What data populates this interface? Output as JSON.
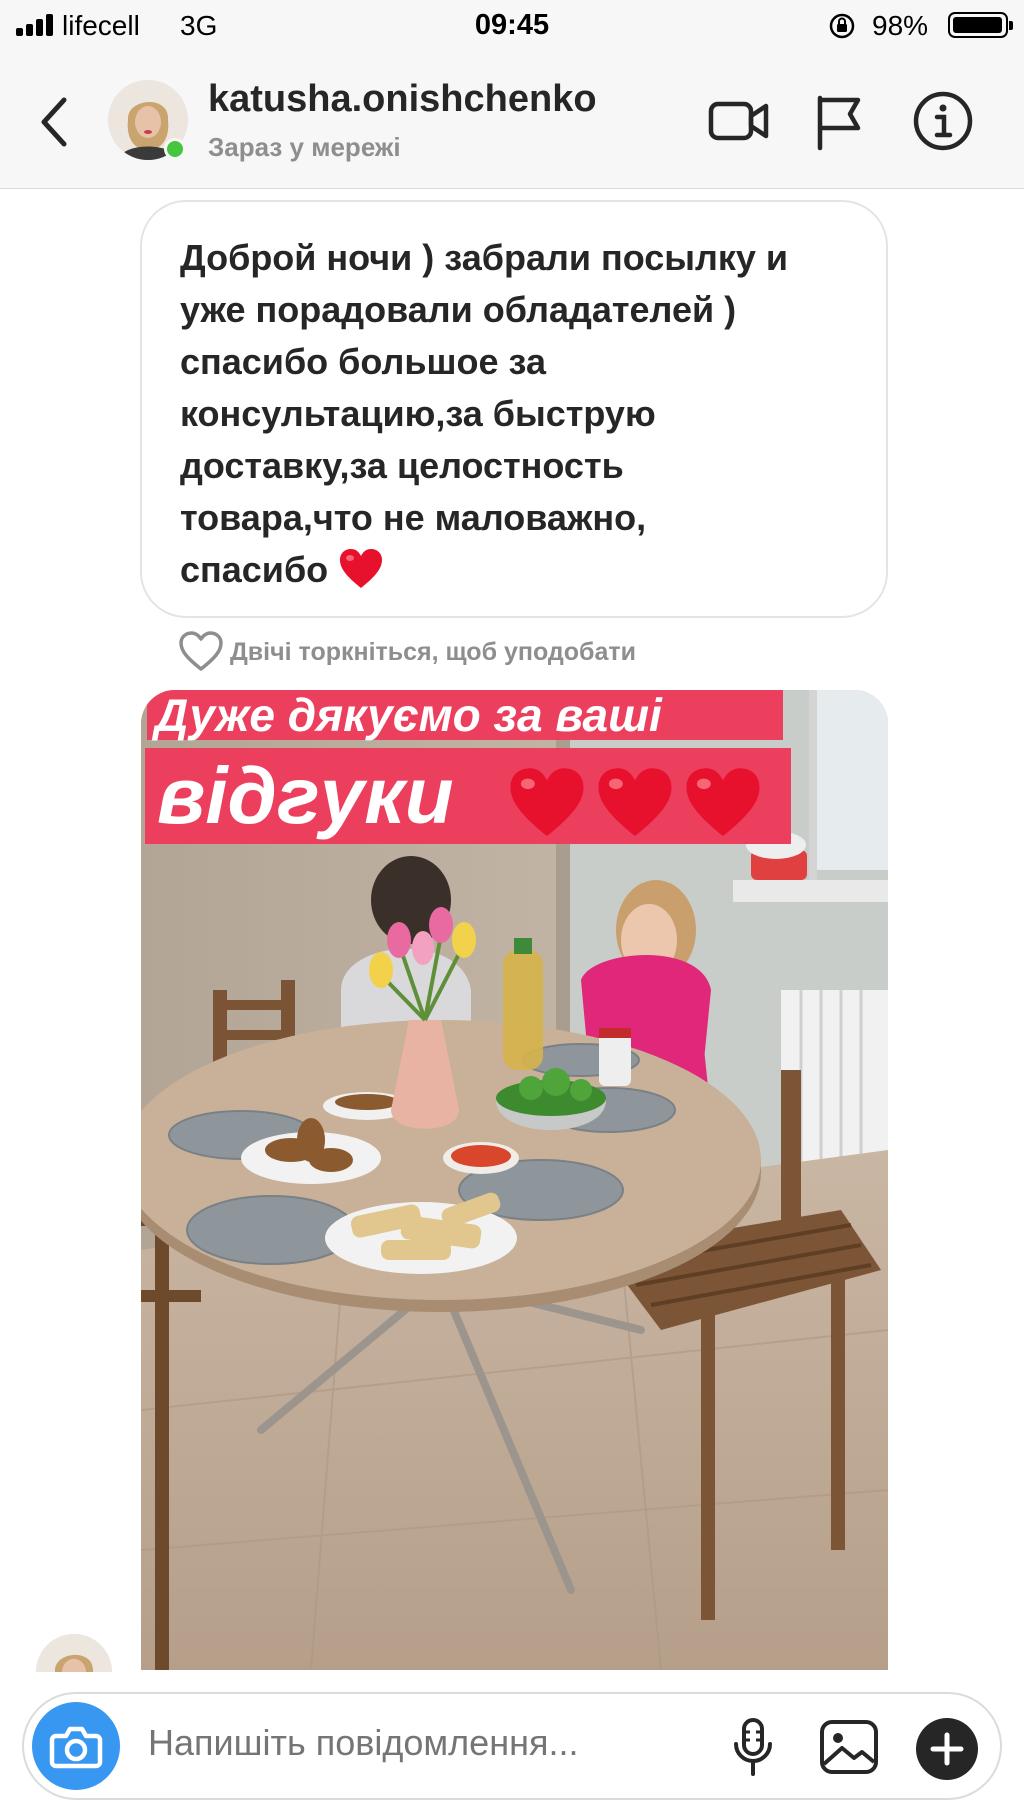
{
  "status_bar": {
    "carrier": "lifecell",
    "network": "3G",
    "time": "09:45",
    "battery": "98%"
  },
  "header": {
    "username": "katusha.onishchenko",
    "status": "Зараз у мережі",
    "icons": [
      "back-icon",
      "video-call-icon",
      "flag-icon",
      "info-icon"
    ]
  },
  "message": {
    "text": "Доброй ночи ) забрали посылку и\nуже порадовали обладателей )\nспасибо большое за\nконсультацию,за быструю\nдоставку,за  целостность\nтовара,что не маловажно,\nспасибо",
    "emoji": "heart"
  },
  "like_hint": "Двічі торкніться, щоб уподобати",
  "story": {
    "banner_line1": "Дуже дякуємо за ваші",
    "banner_line2": "відгуки"
  },
  "composer": {
    "placeholder": "Напишіть повідомлення...",
    "icons": [
      "camera-icon",
      "microphone-icon",
      "gallery-icon",
      "plus-icon"
    ]
  },
  "colors": {
    "accent_blue": "#3897f0",
    "online_green": "#46c53f",
    "banner_red": "#ec3f5d",
    "heart_red": "#e8112d"
  }
}
